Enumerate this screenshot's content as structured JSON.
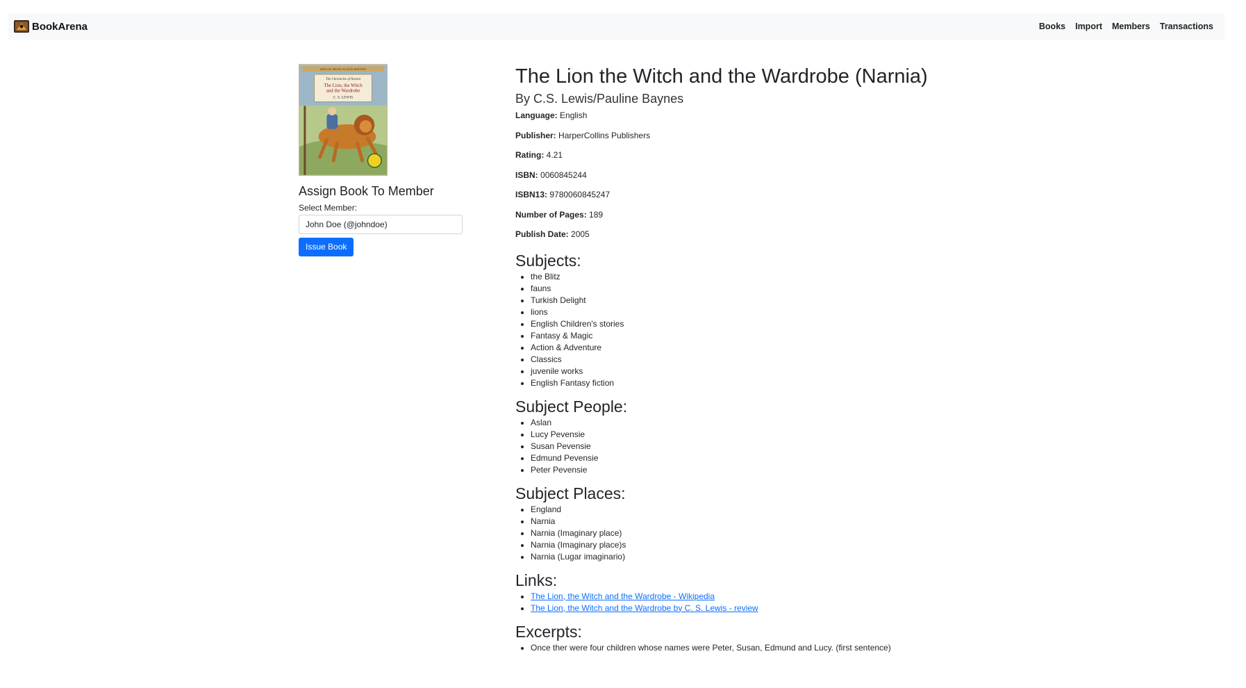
{
  "nav": {
    "brand": "BookArena",
    "links": [
      "Books",
      "Import",
      "Members",
      "Transactions"
    ]
  },
  "assign": {
    "title": "Assign Book To Member",
    "select_label": "Select Member:",
    "selected_member": "John Doe (@johndoe)",
    "button": "Issue Book"
  },
  "book": {
    "title": "The Lion the Witch and the Wardrobe (Narnia)",
    "author": "By C.S. Lewis/Pauline Baynes",
    "details": [
      {
        "label": "Language:",
        "value": "English"
      },
      {
        "label": "Publisher:",
        "value": "HarperCollins Publishers"
      },
      {
        "label": "Rating:",
        "value": "4.21"
      },
      {
        "label": "ISBN:",
        "value": "0060845244"
      },
      {
        "label": "ISBN13:",
        "value": "9780060845247"
      },
      {
        "label": "Number of Pages:",
        "value": "189"
      },
      {
        "label": "Publish Date:",
        "value": "2005"
      }
    ]
  },
  "sections": {
    "subjects": {
      "heading": "Subjects:",
      "items": [
        "the Blitz",
        "fauns",
        "Turkish Delight",
        "lions",
        "English Children's stories",
        "Fantasy & Magic",
        "Action & Adventure",
        "Classics",
        "juvenile works",
        "English Fantasy fiction"
      ]
    },
    "people": {
      "heading": "Subject People:",
      "items": [
        "Aslan",
        "Lucy Pevensie",
        "Susan Pevensie",
        "Edmund Pevensie",
        "Peter Pevensie"
      ]
    },
    "places": {
      "heading": "Subject Places:",
      "items": [
        "England",
        "Narnia",
        "Narnia (Imaginary place)",
        "Narnia (Imaginary place)s",
        "Narnia (Lugar imaginario)"
      ]
    },
    "links": {
      "heading": "Links:",
      "items": [
        "The Lion, the Witch and the Wardrobe - Wikipedia",
        "The Lion, the Witch and the Wardrobe by C. S. Lewis - review"
      ]
    },
    "excerpts": {
      "heading": "Excerpts:",
      "items": [
        "Once ther were four children whose names were Peter, Susan, Edmund and Lucy. (first sentence)"
      ]
    }
  },
  "cover": {
    "series": "The Chronicles of Narnia",
    "title": "The Lion, the Witch and the Wardrobe",
    "author": "C. S. LEWIS",
    "banner": "SPECIAL READ-ALOUD EDITION"
  },
  "colors": {
    "accent": "#0d6efd",
    "navbar_bg": "#f8f9fa"
  }
}
